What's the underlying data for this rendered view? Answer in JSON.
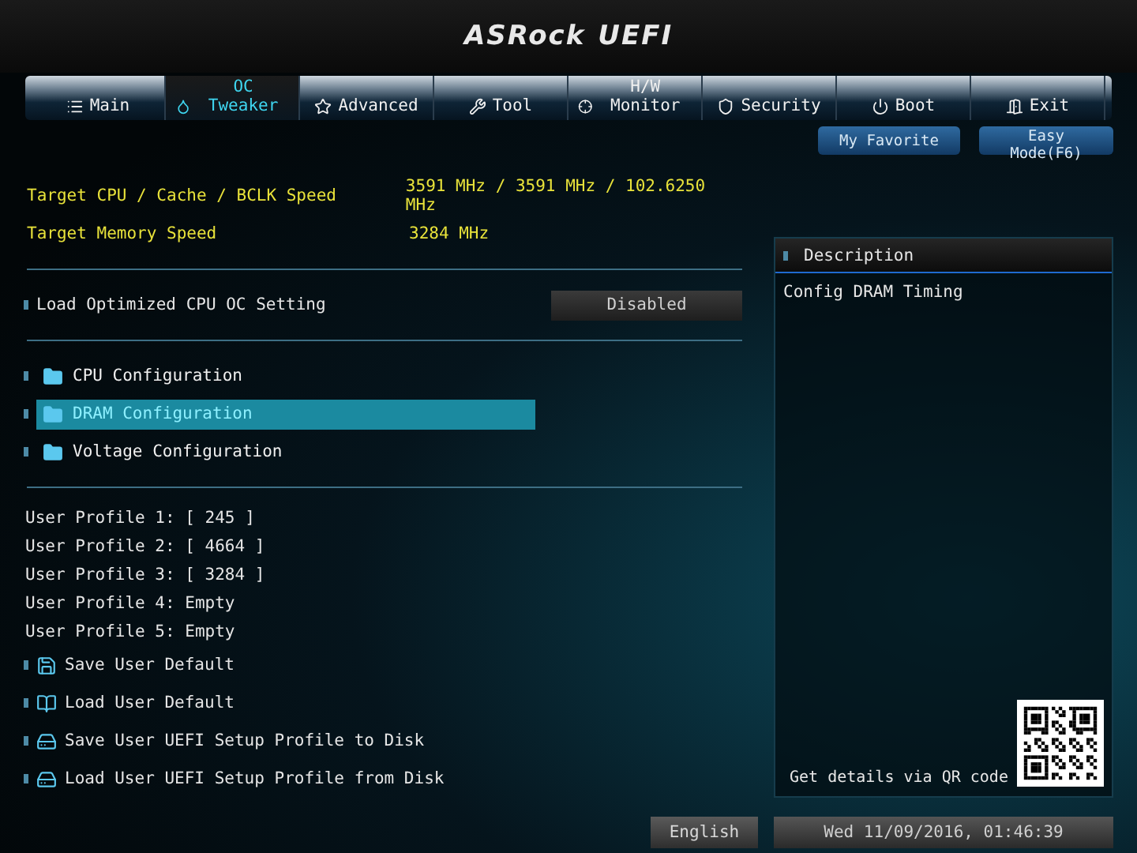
{
  "logo": {
    "brand": "ASRock",
    "product": "UEFI"
  },
  "tabs": [
    {
      "label": "Main",
      "selected": false
    },
    {
      "label": "OC Tweaker",
      "selected": true
    },
    {
      "label": "Advanced",
      "selected": false
    },
    {
      "label": "Tool",
      "selected": false
    },
    {
      "label": "H/W Monitor",
      "selected": false
    },
    {
      "label": "Security",
      "selected": false
    },
    {
      "label": "Boot",
      "selected": false
    },
    {
      "label": "Exit",
      "selected": false
    }
  ],
  "top_buttons": [
    "My Favorite",
    "Easy Mode(F6)"
  ],
  "info": [
    {
      "label": "Target CPU / Cache / BCLK Speed",
      "value": "3591 MHz / 3591 MHz / 102.6250 MHz"
    },
    {
      "label": "Target Memory Speed",
      "value": "3284 MHz"
    }
  ],
  "setting": {
    "label": "Load Optimized CPU OC Setting",
    "value": "Disabled"
  },
  "submenus": [
    {
      "label": "CPU Configuration",
      "selected": false
    },
    {
      "label": "DRAM Configuration",
      "selected": true
    },
    {
      "label": "Voltage Configuration",
      "selected": false
    }
  ],
  "profiles": [
    "User Profile 1: [ 245 ]",
    "User Profile 2: [ 4664 ]",
    "User Profile 3: [ 3284 ]",
    "User Profile 4: Empty",
    "User Profile 5: Empty"
  ],
  "actions": [
    {
      "label": "Save User Default",
      "kind": "save"
    },
    {
      "label": "Load User Default",
      "kind": "load"
    },
    {
      "label": "Save User UEFI Setup Profile to Disk",
      "kind": "disk"
    },
    {
      "label": "Load User UEFI Setup Profile from Disk",
      "kind": "disk"
    }
  ],
  "description": {
    "title": "Description",
    "text": "Config DRAM Timing",
    "qr_label": "Get details via QR code"
  },
  "status_bar": {
    "language": "English",
    "datetime": "Wed 11/09/2016, 01:46:39"
  }
}
